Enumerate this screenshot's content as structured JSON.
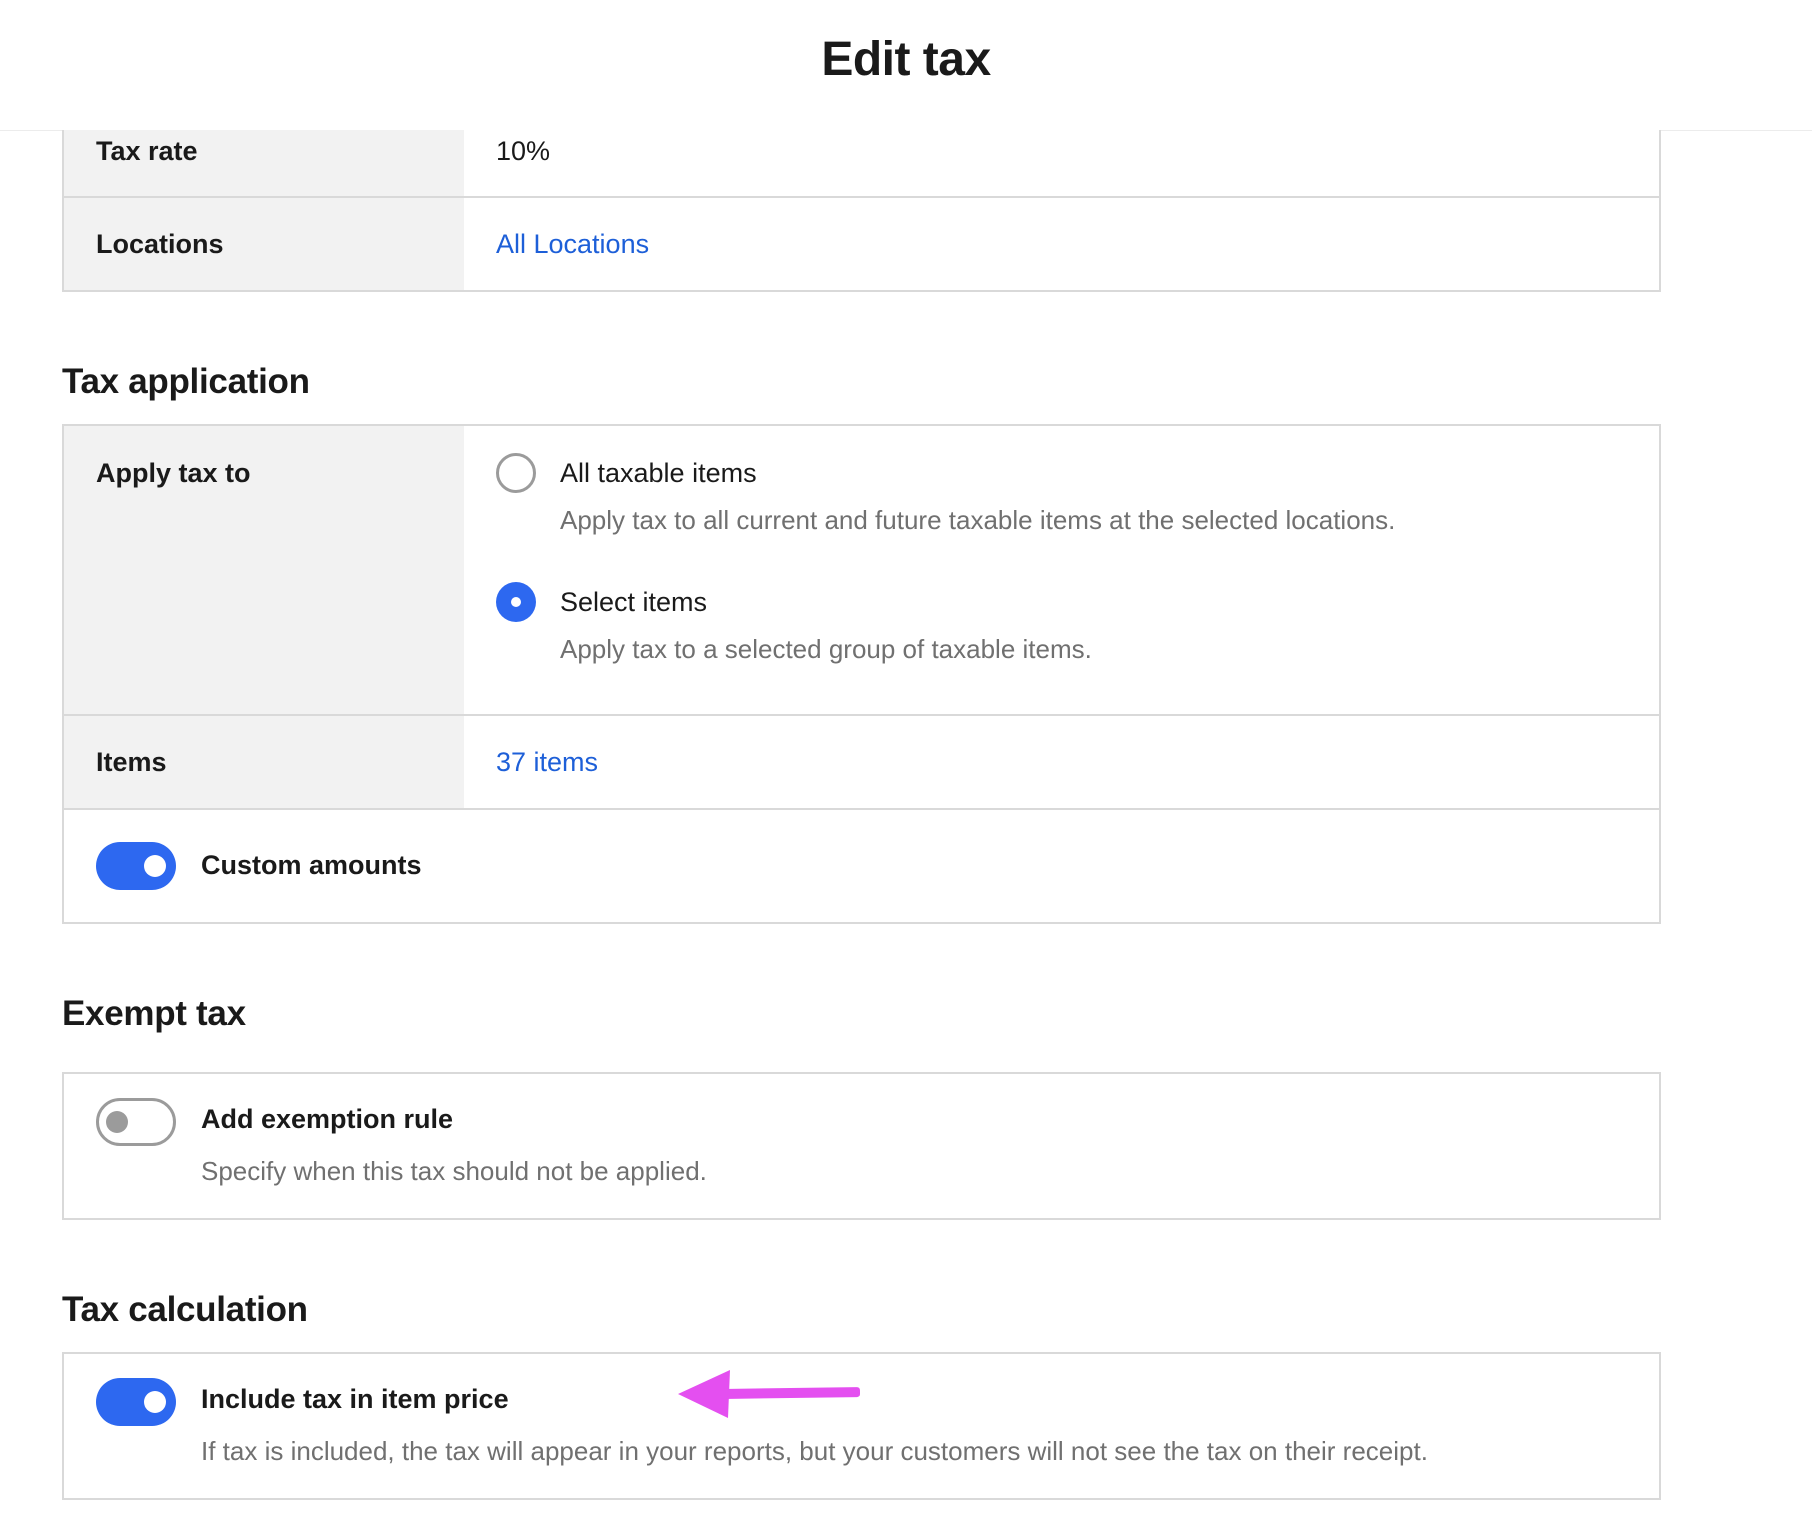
{
  "header": {
    "title": "Edit tax"
  },
  "details": {
    "rows": [
      {
        "label": "Tax rate",
        "value": "10%"
      },
      {
        "label": "Locations",
        "value": "All Locations"
      }
    ]
  },
  "tax_application": {
    "heading": "Tax application",
    "apply_tax_to": {
      "label": "Apply tax to",
      "options": [
        {
          "title": "All taxable items",
          "description": "Apply tax to all current and future taxable items at the selected locations.",
          "selected": false
        },
        {
          "title": "Select items",
          "description": "Apply tax to a selected group of taxable items.",
          "selected": true
        }
      ]
    },
    "items": {
      "label": "Items",
      "value": "37 items"
    },
    "custom_amounts": {
      "label": "Custom amounts",
      "enabled": true
    }
  },
  "exempt_tax": {
    "heading": "Exempt tax",
    "rule": {
      "label": "Add exemption rule",
      "description": "Specify when this tax should not be applied.",
      "enabled": false
    }
  },
  "tax_calculation": {
    "heading": "Tax calculation",
    "include_in_price": {
      "label": "Include tax in item price",
      "description": "If tax is included, the tax will appear in your reports, but your customers will not see the tax on their receipt.",
      "enabled": true
    }
  },
  "colors": {
    "accent": "#2d68f0",
    "link": "#1d5fd8",
    "annotation_arrow": "#e44ff0"
  },
  "annotation": {
    "icon": "arrow-left-icon"
  }
}
